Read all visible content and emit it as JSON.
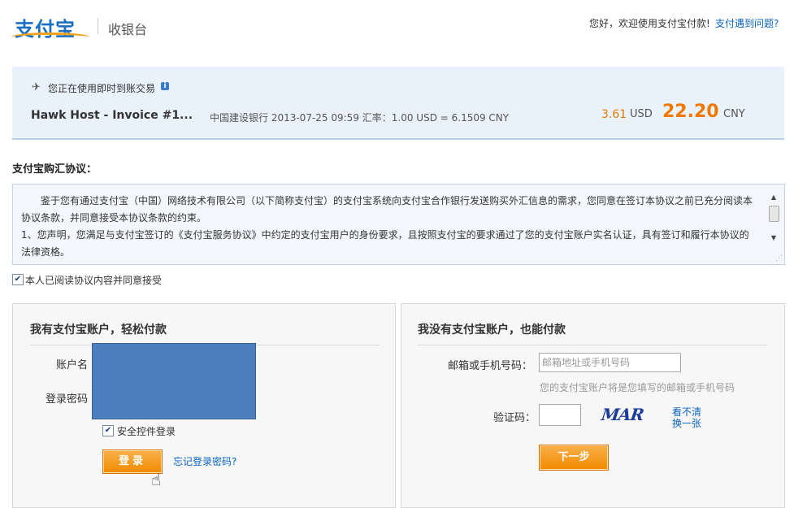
{
  "header": {
    "logo_text": "支付宝",
    "subtitle": "收银台",
    "greeting": "您好，欢迎使用支付宝付款!",
    "help_link": "支付遇到问题?"
  },
  "transaction": {
    "mode_text": "您正在使用即时到账交易",
    "info_icon": "i",
    "merchant": "Hawk Host - Invoice #1...",
    "detail": "中国建设银行 2013-07-25 09:59 汇率：1.00 USD = 6.1509 CNY",
    "amount_usd": "3.61",
    "unit_usd": "USD",
    "amount_cny": "22.20",
    "unit_cny": "CNY"
  },
  "agreement": {
    "title": "支付宝购汇协议：",
    "paragraph1": "鉴于您有通过支付宝（中国）网络技术有限公司（以下简称支付宝）的支付宝系统向支付宝合作银行发送购买外汇信息的需求，您同意在签订本协议之前已充分阅读本协议条款，并同意接受本协议条款的约束。",
    "paragraph2": "1、您声明，您满足与支付宝签订的《支付宝服务协议》中约定的支付宝用户的身份要求，且按照支付宝的要求通过了您的支付宝账户实名认证，具有签订和履行本协议的法律资格。",
    "accept_label": "本人已阅读协议内容并同意接受",
    "accept_checked": true
  },
  "left_panel": {
    "title": "我有支付宝账户，轻松付款",
    "account_label": "账户名",
    "password_label": "登录密码",
    "secure_label": "安全控件登录",
    "secure_checked": true,
    "login_button": "登录",
    "forgot_link": "忘记登录密码?"
  },
  "right_panel": {
    "title": "我没有支付宝账户，也能付款",
    "contact_label": "邮箱或手机号码：",
    "contact_placeholder": "邮箱地址或手机号码",
    "contact_hint": "您的支付宝账户将是您填写的邮箱或手机号码",
    "captcha_label": "验证码：",
    "captcha_text": "MAR",
    "refresh_link_line1": "看不清",
    "refresh_link_line2": "换一张",
    "next_button": "下一步"
  },
  "colors": {
    "accent_orange": "#f08a00",
    "link_blue": "#0b64c0",
    "panel_blue": "#e9f2fb",
    "redaction_blue": "#4d7fbe"
  }
}
